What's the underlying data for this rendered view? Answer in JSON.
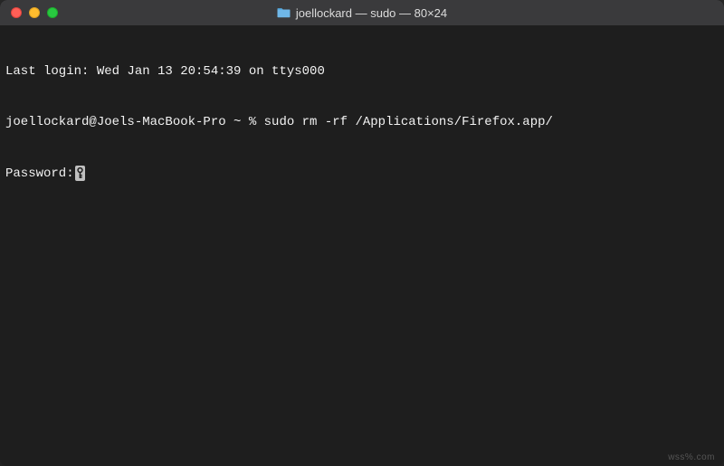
{
  "window": {
    "title": "joellockard — sudo — 80×24"
  },
  "terminal": {
    "last_login": "Last login: Wed Jan 13 20:54:39 on ttys000",
    "prompt_line": "joellockard@Joels-MacBook-Pro ~ % sudo rm -rf /Applications/Firefox.app/",
    "password_label": "Password:"
  },
  "watermark": "wss%.com"
}
